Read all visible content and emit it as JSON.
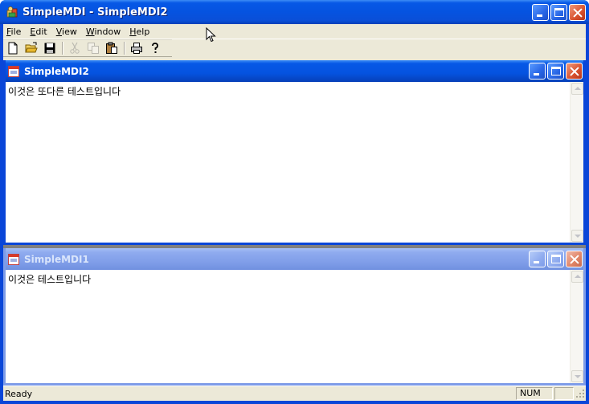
{
  "app": {
    "title": "SimpleMDI - SimpleMDI2"
  },
  "menu": {
    "items": [
      {
        "accel": "F",
        "rest": "ile"
      },
      {
        "accel": "E",
        "rest": "dit"
      },
      {
        "accel": "V",
        "rest": "iew"
      },
      {
        "accel": "W",
        "rest": "indow"
      },
      {
        "accel": "H",
        "rest": "elp"
      }
    ]
  },
  "toolbar": {
    "buttons": [
      "new-document-icon",
      "open-folder-icon",
      "save-disk-icon",
      "cut-scissors-icon",
      "copy-icon",
      "paste-clipboard-icon",
      "print-icon",
      "help-question-icon"
    ]
  },
  "children": [
    {
      "title": "SimpleMDI2",
      "text": "이것은 또다른 테스트입니다",
      "active": true
    },
    {
      "title": "SimpleMDI1",
      "text": "이것은 테스트입니다",
      "active": false
    }
  ],
  "status": {
    "text": "Ready",
    "num": "NUM"
  },
  "colors": {
    "xp_blue": "#0a46d8",
    "inactive_blue": "#7e9ce8",
    "face": "#ece9d8",
    "close_red": "#d8512d"
  }
}
